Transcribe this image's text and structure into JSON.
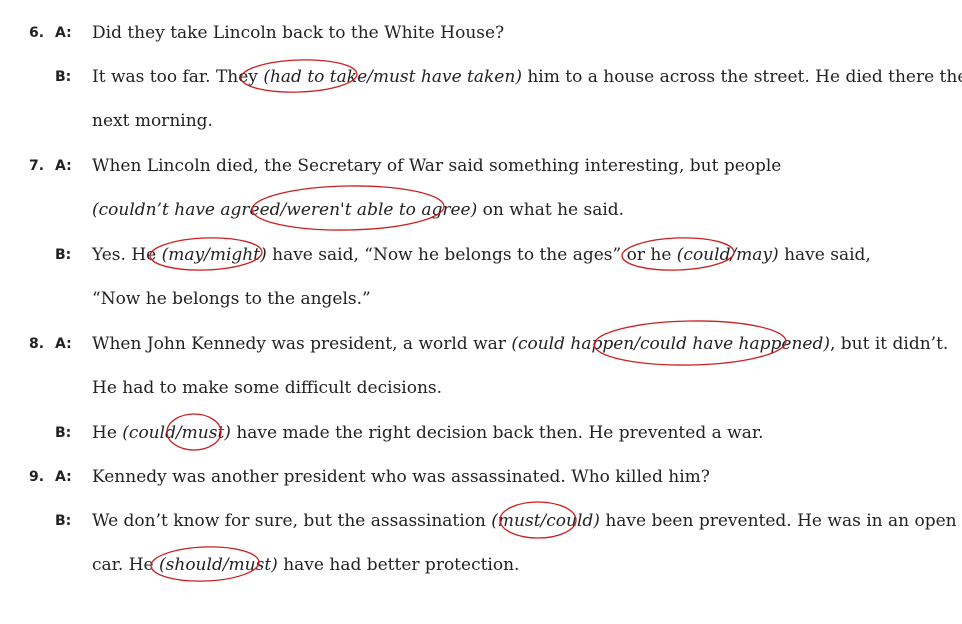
{
  "items": [
    {
      "number": "6.",
      "a_label": "A:",
      "b_label": "B:",
      "a_line1": "Did they take Lincoln back to the White House?",
      "b_line1_pre": "It was too far. They ",
      "b_line1_choice": "(had to take/must have taken)",
      "b_line1_post": " him to a house across the street. He died there the",
      "b_line2": "next morning."
    },
    {
      "number": "7.",
      "a_label": "A:",
      "b_label": "B:",
      "a_line1": "When Lincoln died, the Secretary of War said something interesting, but people",
      "a_line2_choice": "(couldn’t have agreed/weren't able to agree)",
      "a_line2_post": " on what he said.",
      "b_line1_pre": "Yes. He ",
      "b_line1_choice1": "(may/might)",
      "b_line1_mid": " have said, “Now he belongs to the ages” or he ",
      "b_line1_choice2": "(could/may)",
      "b_line1_post": " have said,",
      "b_line2": "“Now he belongs to the angels.”"
    },
    {
      "number": "8.",
      "a_label": "A:",
      "b_label": "B:",
      "a_line1_pre": "When John Kennedy was president, a world war ",
      "a_line1_choice": "(could happen/could have happened)",
      "a_line1_post": ", but it didn’t.",
      "a_line2": "He had to make some difficult decisions.",
      "b_line1_pre": "He ",
      "b_line1_choice": "(could/must)",
      "b_line1_post": " have made the right decision back then. He prevented a war."
    },
    {
      "number": "9.",
      "a_label": "A:",
      "b_label": "B:",
      "a_line1": "Kennedy was another president who was assassinated. Who killed him?",
      "b_line1_pre": "We don’t know for sure, but the assassination ",
      "b_line1_choice": "(must/could)",
      "b_line1_post": " have been prevented. He was in an open",
      "b_line2_pre": "car. He ",
      "b_line2_choice": "(should/must)",
      "b_line2_post": " have had better protection."
    }
  ],
  "colors": {
    "circle": "#cc1f1f",
    "text": "#222222"
  }
}
